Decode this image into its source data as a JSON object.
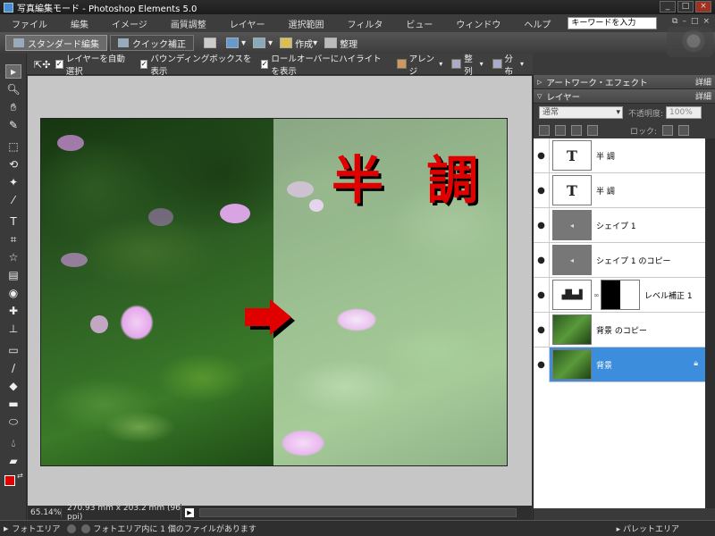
{
  "titlebar": {
    "title": "写真編集モード - Photoshop Elements 5.0",
    "ctrls": [
      "_",
      "□",
      "×"
    ]
  },
  "menu": {
    "items": [
      "ファイル",
      "編集",
      "イメージ",
      "画質調整",
      "レイヤー",
      "選択範囲",
      "フィルタ",
      "ビュー",
      "ウィンドウ",
      "ヘルプ"
    ],
    "search_placeholder": "キーワードを入力",
    "mini_ctrls": [
      "⧉",
      "–",
      "□",
      "×"
    ]
  },
  "modebar": {
    "standard": "スタンダード編集",
    "quick": "クイック補正",
    "create": "作成",
    "organize": "整理"
  },
  "options": {
    "auto_select": "レイヤーを自動選択",
    "bounding_box": "バウンディングボックスを表示",
    "rollover": "ロールオーバーにハイライトを表示",
    "arrange": "アレンジ",
    "align": "整列",
    "distribute": "分布"
  },
  "canvas": {
    "overlay_text": "半 調"
  },
  "docstatus": {
    "zoom": "65.14%",
    "size": "270.93 mm x 203.2 mm (96 ppi)"
  },
  "panels": {
    "artwork": "アートワーク・エフェクト",
    "artwork_more": "詳細",
    "layers": "レイヤー",
    "layers_more": "詳細",
    "blend_mode": "通常",
    "opacity_label": "不透明度:",
    "opacity_value": "100%",
    "lock_label": "ロック:",
    "layers_list": [
      {
        "name": "半 調",
        "kind": "text"
      },
      {
        "name": "半 調",
        "kind": "text"
      },
      {
        "name": "シェイプ 1",
        "kind": "shape"
      },
      {
        "name": "シェイプ 1 のコピー",
        "kind": "shape"
      },
      {
        "name": "レベル補正 1",
        "kind": "levels"
      },
      {
        "name": "背景 のコピー",
        "kind": "photo"
      },
      {
        "name": "背景",
        "kind": "photo",
        "selected": true,
        "locked": true
      }
    ]
  },
  "bottombar": {
    "photo_bin": "フォトエリア",
    "bin_status": "フォトエリア内に 1 個のファイルがあります",
    "palette_bin": "パレットエリア"
  },
  "colors": {
    "foreground": "#e00000",
    "background": "#ffffff",
    "selected_layer": "#3c8edc",
    "text_red": "#e00000"
  }
}
